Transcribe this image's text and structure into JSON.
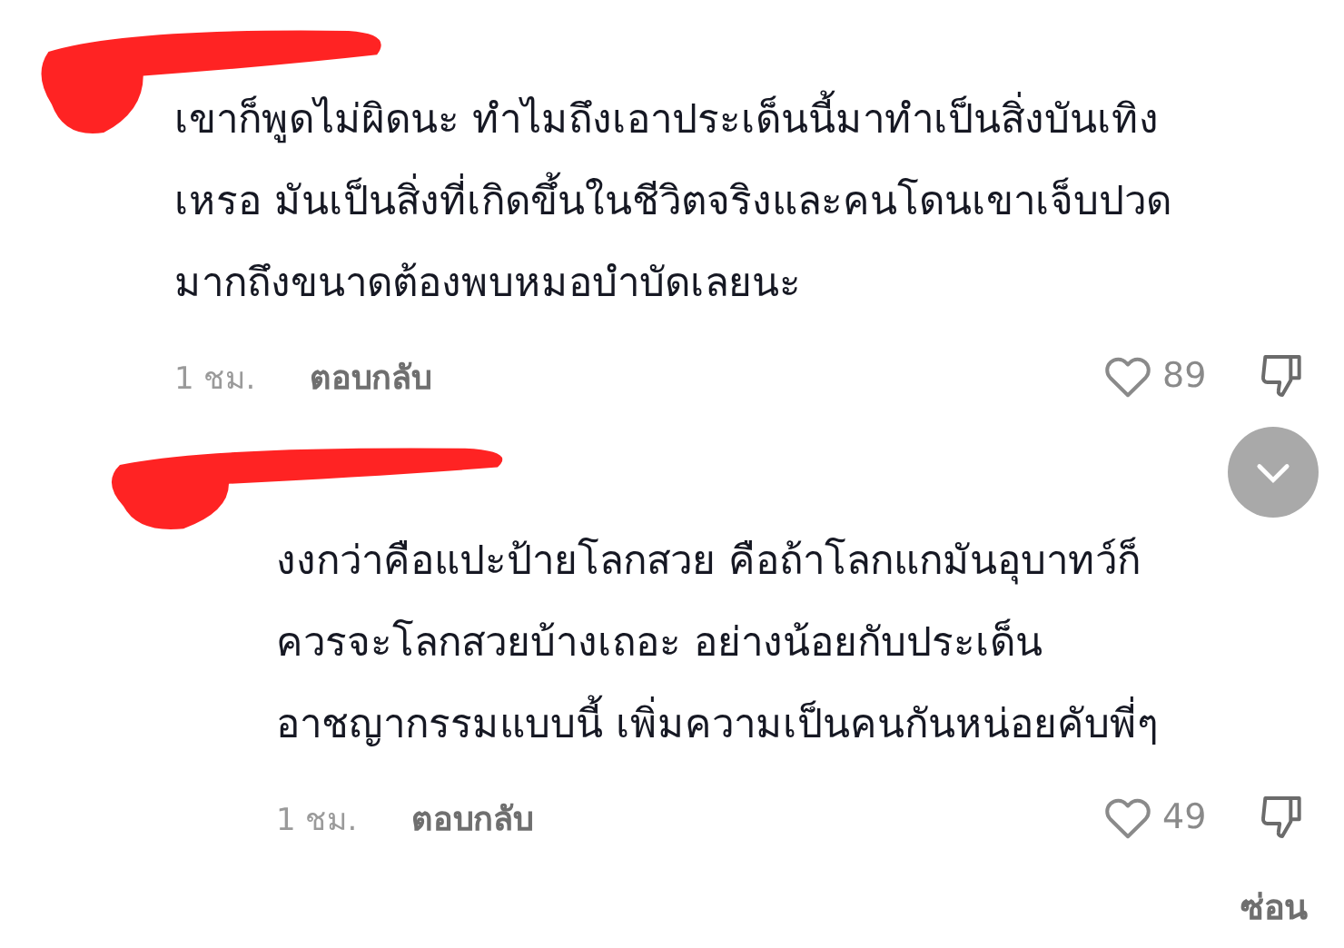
{
  "comments": [
    {
      "kind": "comment",
      "lines": [
        "เขาก็พูดไม่ผิดนะ ทำไมถึงเอาประเด็นนี้มาทำเป็นสิ่งบันเทิง",
        "เหรอ มันเป็นสิ่งที่เกิดขึ้นในชีวิตจริงและคนโดนเขาเจ็บปวด",
        "มากถึงขนาดต้องพบหมอบำบัดเลยนะ"
      ],
      "time": "1 ชม.",
      "reply": "ตอบกลับ",
      "likes": "89"
    },
    {
      "kind": "reply",
      "lines": [
        "งงกว่าคือแปะป้ายโลกสวย คือถ้าโลกแกมันอุบาทว์ก็",
        "ควรจะโลกสวยบ้างเถอะ อย่างน้อยกับประเด็น",
        "อาชญากรรมแบบนี้ เพิ่มความเป็นคนกันหน่อยคับพี่ๆ"
      ],
      "time": "1 ชม.",
      "reply": "ตอบกลับ",
      "likes": "49"
    }
  ],
  "hide_label": "ซ่อน"
}
